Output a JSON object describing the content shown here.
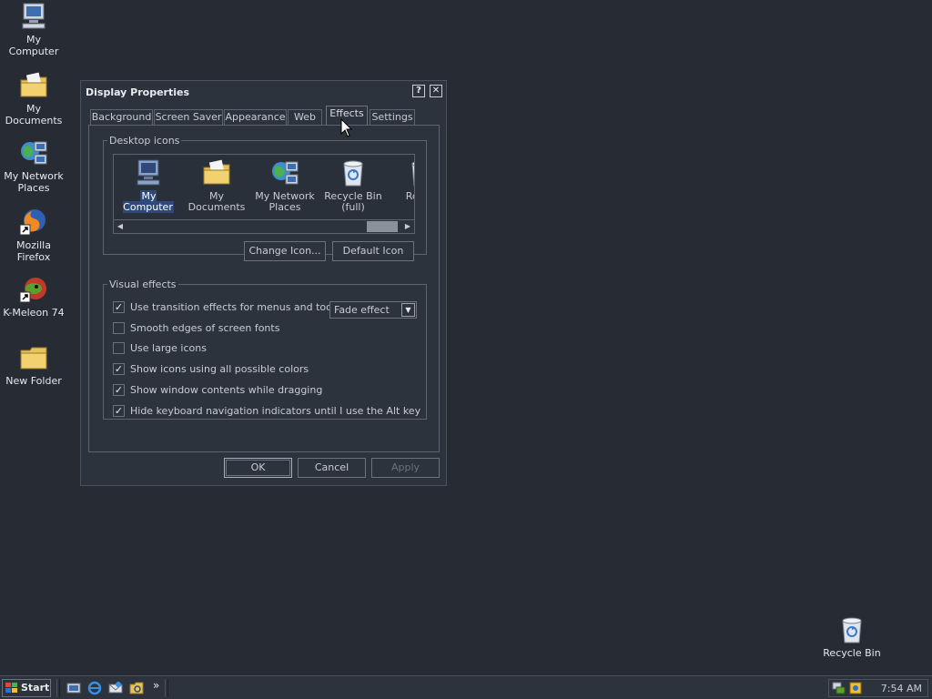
{
  "desktop": {
    "icons": [
      {
        "label": "My Computer",
        "icon": "computer-icon"
      },
      {
        "label": "My Documents",
        "icon": "folder-documents-icon"
      },
      {
        "label": "My Network Places",
        "icon": "network-places-icon"
      },
      {
        "label": "Mozilla Firefox",
        "icon": "firefox-icon"
      },
      {
        "label": "K-Meleon 74",
        "icon": "kmeleon-icon"
      },
      {
        "label": "New Folder",
        "icon": "folder-icon"
      },
      {
        "label": "Recycle Bin",
        "icon": "recycle-bin-icon"
      }
    ]
  },
  "dialog": {
    "title": "Display Properties",
    "help_glyph": "?",
    "close_glyph": "✕",
    "tabs": [
      {
        "label": "Background"
      },
      {
        "label": "Screen Saver"
      },
      {
        "label": "Appearance"
      },
      {
        "label": "Web"
      },
      {
        "label": "Effects",
        "active": true
      },
      {
        "label": "Settings"
      }
    ],
    "desktop_icons": {
      "legend": "Desktop icons",
      "items": [
        {
          "label": "My Computer",
          "selected": true
        },
        {
          "label": "My Documents"
        },
        {
          "label": "My Network Places"
        },
        {
          "label": "Recycle Bin (full)"
        },
        {
          "label": "Rec (e"
        }
      ],
      "change_icon_label": "Change Icon...",
      "default_icon_label": "Default Icon"
    },
    "visual_effects": {
      "legend": "Visual effects",
      "options": [
        {
          "label": "Use transition effects for menus and tooltips",
          "checked": true
        },
        {
          "label": "Smooth edges of screen fonts",
          "checked": false
        },
        {
          "label": "Use large icons",
          "checked": false
        },
        {
          "label": "Show icons using all possible colors",
          "checked": true
        },
        {
          "label": "Show window contents while dragging",
          "checked": true
        },
        {
          "label": "Hide keyboard navigation indicators until I use the Alt key",
          "checked": true
        }
      ],
      "transition_effect": "Fade effect"
    },
    "buttons": {
      "ok": "OK",
      "cancel": "Cancel",
      "apply": "Apply"
    }
  },
  "taskbar": {
    "start_label": "Start",
    "overflow_glyph": "»",
    "clock": "7:54 AM"
  },
  "colors": {
    "desktop": "#262b34",
    "window": "#2c333d",
    "selection": "#2f4a7a"
  }
}
